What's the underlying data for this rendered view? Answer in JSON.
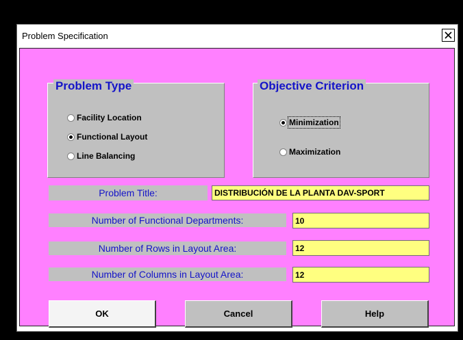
{
  "window": {
    "title": "Problem Specification"
  },
  "problem_type": {
    "title": "Problem Type",
    "options": [
      {
        "label": "Facility Location",
        "selected": false
      },
      {
        "label": "Functional Layout",
        "selected": true
      },
      {
        "label": "Line Balancing",
        "selected": false
      }
    ]
  },
  "objective": {
    "title": "Objective Criterion",
    "options": [
      {
        "label": "Minimization",
        "selected": true
      },
      {
        "label": "Maximization",
        "selected": false
      }
    ]
  },
  "fields": {
    "problem_title": {
      "label": "Problem Title:",
      "value": "DISTRIBUCIÓN DE LA PLANTA DAV-SPORT"
    },
    "departments": {
      "label": "Number of Functional Departments:",
      "value": "10"
    },
    "rows": {
      "label": "Number of Rows in Layout Area:",
      "value": "12"
    },
    "columns": {
      "label": "Number of Columns in Layout Area:",
      "value": "12"
    }
  },
  "buttons": {
    "ok": "OK",
    "cancel": "Cancel",
    "help": "Help"
  },
  "colors": {
    "dialog_background": "#ff80ff",
    "panel_gray": "#c0c0c0",
    "label_blue": "#1414c8",
    "field_yellow": "#ffff80"
  }
}
